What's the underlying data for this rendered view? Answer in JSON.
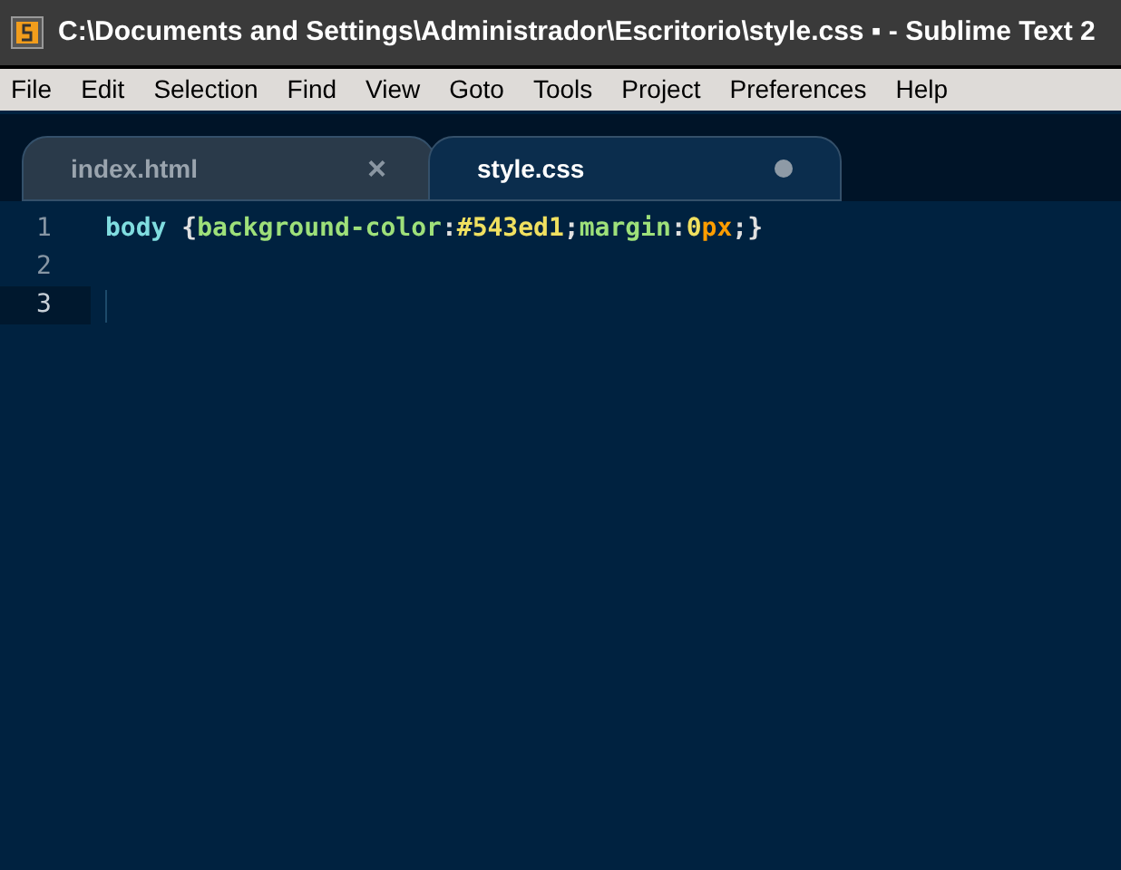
{
  "window": {
    "title": "C:\\Documents and Settings\\Administrador\\Escritorio\\style.css ▪ - Sublime Text 2"
  },
  "menu": [
    "File",
    "Edit",
    "Selection",
    "Find",
    "View",
    "Goto",
    "Tools",
    "Project",
    "Preferences",
    "Help"
  ],
  "tabs": [
    {
      "label": "index.html",
      "selected": false,
      "modified": false,
      "close": "×"
    },
    {
      "label": "style.css",
      "selected": true,
      "modified": true
    }
  ],
  "editor": {
    "lines": [
      {
        "number": "1",
        "current": false,
        "tokens": [
          {
            "kind": "selector",
            "text": "body "
          },
          {
            "kind": "punct",
            "text": "{"
          },
          {
            "kind": "property",
            "text": "background-color"
          },
          {
            "kind": "punct",
            "text": ":"
          },
          {
            "kind": "value",
            "text": "#543ed1"
          },
          {
            "kind": "punct",
            "text": ";"
          },
          {
            "kind": "property",
            "text": "margin"
          },
          {
            "kind": "punct",
            "text": ":"
          },
          {
            "kind": "value",
            "text": "0"
          },
          {
            "kind": "unit",
            "text": "px"
          },
          {
            "kind": "punct",
            "text": ";}"
          }
        ]
      },
      {
        "number": "2",
        "current": false
      },
      {
        "number": "3",
        "current": true
      }
    ]
  }
}
